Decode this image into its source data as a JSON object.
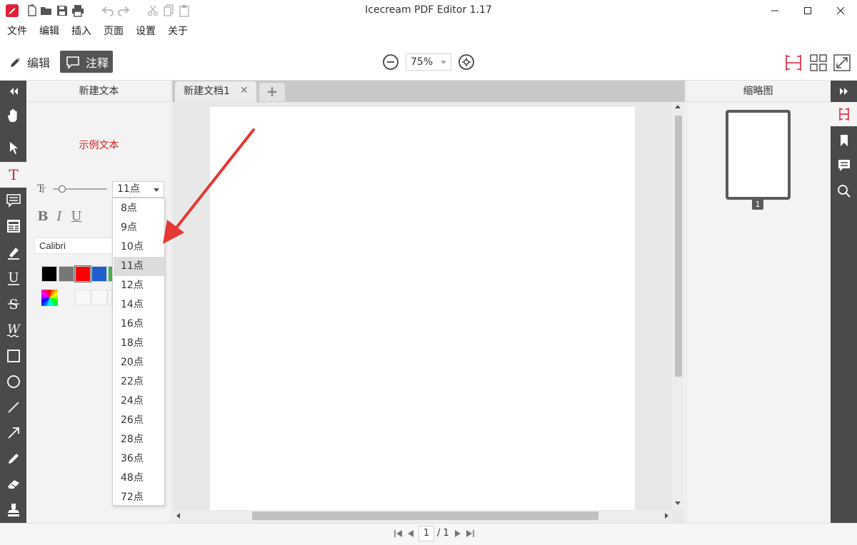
{
  "window": {
    "title": "Icecream PDF Editor 1.17"
  },
  "menu": [
    "文件",
    "编辑",
    "插入",
    "页面",
    "设置",
    "关于"
  ],
  "toolbar": {
    "edit_label": "编辑",
    "annotate_label": "注释",
    "zoom_value": "75%"
  },
  "props_panel": {
    "title": "新建文本",
    "sample_text": "示例文本",
    "sample_color": "#cc2222",
    "font_size_selected": "11点",
    "bold_label": "B",
    "italic_label": "I",
    "underline_label": "U",
    "font_name": "Calibri",
    "colors": [
      "#000000",
      "#777777",
      "#ff0000",
      "#1f5fcc",
      "#4caf50"
    ],
    "selected_color_index": 2
  },
  "font_size_options": [
    "8点",
    "9点",
    "10点",
    "11点",
    "12点",
    "14点",
    "16点",
    "18点",
    "20点",
    "22点",
    "24点",
    "26点",
    "28点",
    "36点",
    "48点",
    "72点"
  ],
  "font_size_highlight_index": 3,
  "document": {
    "tab_name": "新建文档1",
    "close_symbol": "✕",
    "new_tab_symbol": "+"
  },
  "thumbnails": {
    "title": "缩略图",
    "page_number": "1"
  },
  "statusbar": {
    "current_page": "1",
    "total_pages": "/ 1"
  },
  "theme": {
    "accent": "#e0203a",
    "strip_bg": "#4a4a4a"
  }
}
